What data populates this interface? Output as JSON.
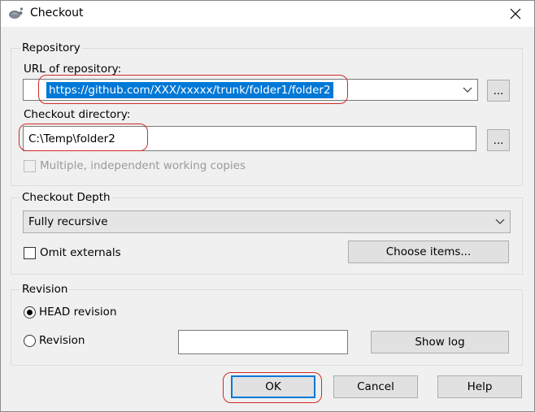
{
  "window": {
    "title": "Checkout",
    "close_label": "✕"
  },
  "repository": {
    "group_label": "Repository",
    "url_label": "URL of repository:",
    "url_value": "https://github.com/XXX/xxxxx/trunk/folder1/folder2",
    "browse_label": "...",
    "checkout_dir_label": "Checkout directory:",
    "checkout_dir_value": "C:\\Temp\\folder2",
    "browse_dir_label": "...",
    "multiple_label": "Multiple, independent working copies"
  },
  "depth": {
    "group_label": "Checkout Depth",
    "selected": "Fully recursive",
    "omit_externals_label": "Omit externals",
    "choose_items_label": "Choose items..."
  },
  "revision": {
    "group_label": "Revision",
    "head_label": "HEAD revision",
    "revision_label": "Revision",
    "revision_value": "",
    "show_log_label": "Show log"
  },
  "buttons": {
    "ok": "OK",
    "cancel": "Cancel",
    "help": "Help"
  },
  "colors": {
    "accent": "#0078d7",
    "annotation": "#d22a2a"
  }
}
